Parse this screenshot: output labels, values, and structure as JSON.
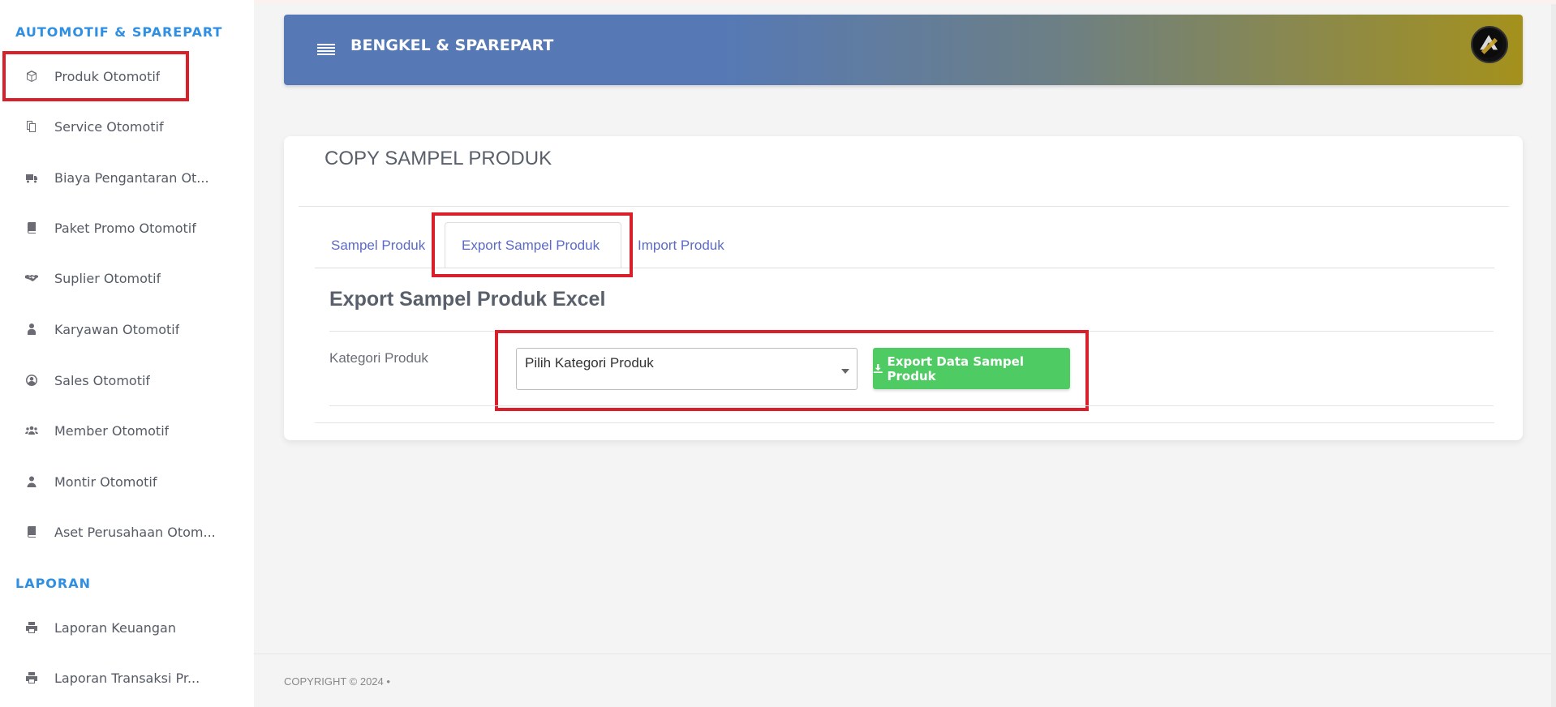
{
  "sidebar": {
    "section_automotive": "AUTOMOTIF & SPAREPART",
    "section_report": "LAPORAN",
    "items": [
      {
        "label": "Produk Otomotif",
        "icon": "cube-icon"
      },
      {
        "label": "Service Otomotif",
        "icon": "copy-icon"
      },
      {
        "label": "Biaya Pengantaran Ot...",
        "icon": "truck-icon"
      },
      {
        "label": "Paket Promo Otomotif",
        "icon": "book-icon"
      },
      {
        "label": "Suplier Otomotif",
        "icon": "handshake-icon"
      },
      {
        "label": "Karyawan Otomotif",
        "icon": "user-tie-icon"
      },
      {
        "label": "Sales Otomotif",
        "icon": "user-circle-icon"
      },
      {
        "label": "Member Otomotif",
        "icon": "users-icon"
      },
      {
        "label": "Montir Otomotif",
        "icon": "user-icon"
      },
      {
        "label": "Aset Perusahaan Otom...",
        "icon": "book-icon"
      }
    ],
    "report_items": [
      {
        "label": "Laporan Keuangan",
        "icon": "print-icon"
      },
      {
        "label": "Laporan Transaksi Pr...",
        "icon": "print-icon"
      }
    ]
  },
  "header": {
    "brand": "BENGKEL & SPAREPART",
    "menu_icon": "hamburger-icon",
    "avatar_icon": "logo-avatar-icon"
  },
  "card": {
    "title": "COPY SAMPEL PRODUK",
    "tabs": [
      {
        "label": "Sampel Produk"
      },
      {
        "label": "Export Sampel Produk",
        "active": true
      },
      {
        "label": "Import Produk"
      }
    ],
    "subtitle": "Export Sampel Produk Excel",
    "field_label": "Kategori Produk",
    "select_value": "Pilih Kategori Produk",
    "export_button": "Export Data Sampel Produk"
  },
  "footer": {
    "copyright": "COPYRIGHT © 2024  •"
  },
  "colors": {
    "accent": "#2f8fe3",
    "tab_link": "#5b6bc6",
    "button_success": "#4fcb63",
    "highlight": "#d9202a"
  }
}
